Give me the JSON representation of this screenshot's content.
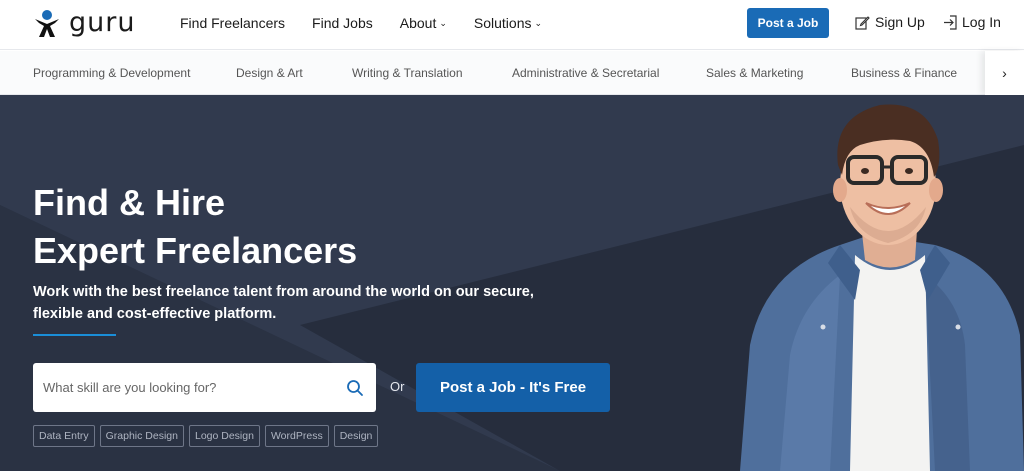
{
  "header": {
    "logo_text": "guru",
    "nav": [
      {
        "label": "Find Freelancers",
        "dropdown": false
      },
      {
        "label": "Find Jobs",
        "dropdown": false
      },
      {
        "label": "About",
        "dropdown": true
      },
      {
        "label": "Solutions",
        "dropdown": true
      }
    ],
    "post_job_label": "Post a Job",
    "signup_label": "Sign Up",
    "login_label": "Log In"
  },
  "categories": [
    "Programming & Development",
    "Design & Art",
    "Writing & Translation",
    "Administrative & Secretarial",
    "Sales & Marketing",
    "Business & Finance"
  ],
  "hero": {
    "title_line1": "Find & Hire",
    "title_line2": "Expert Freelancers",
    "subtitle_line1": "Work with the best freelance talent from around the world on our secure,",
    "subtitle_line2": "flexible and cost-effective platform.",
    "search_placeholder": "What skill are you looking for?",
    "or_label": "Or",
    "cta_label": "Post a Job - It's Free",
    "tags": [
      "Data Entry",
      "Graphic Design",
      "Logo Design",
      "WordPress",
      "Design"
    ]
  },
  "colors": {
    "brand_blue": "#1a6bb6",
    "hero_bg": "#2d3547",
    "accent_line": "#1a8ed8"
  },
  "icons": {
    "logo": "guru-person-icon",
    "signup": "edit-icon",
    "login": "login-arrow-icon",
    "search": "search-icon",
    "category_next": "chevron-right-icon"
  }
}
